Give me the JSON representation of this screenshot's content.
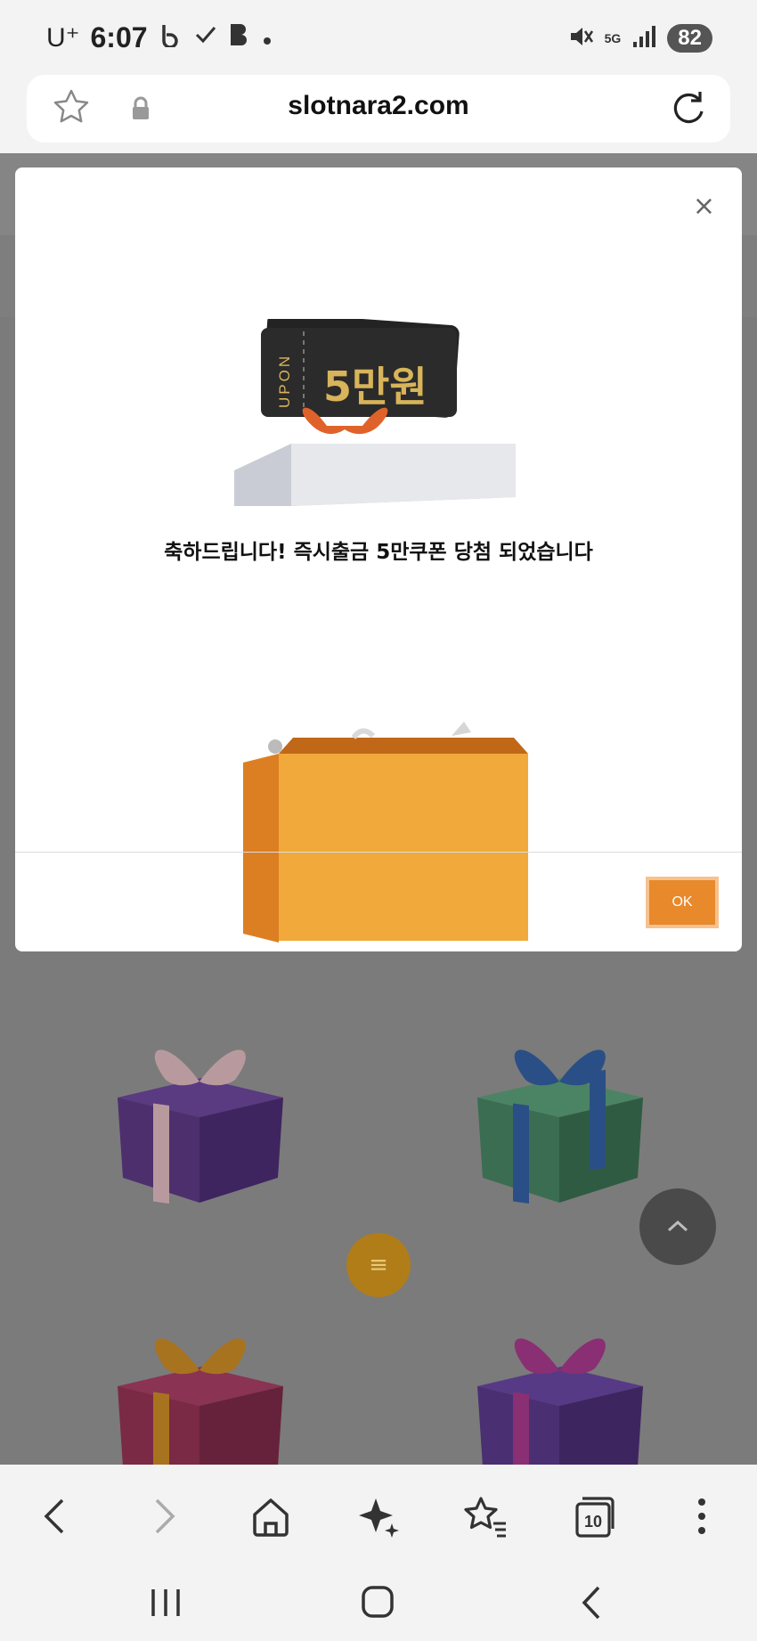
{
  "status_bar": {
    "carrier": "U⁺",
    "time": "6:07",
    "battery": "82",
    "network": "5G"
  },
  "browser": {
    "url": "slotnara2.com"
  },
  "modal": {
    "close_label": "×",
    "coupon_brand": "UPON",
    "coupon_amount": "5만원",
    "message": "축하드립니다! 즉시출금 5만쿠폰 당첨 되었습니다",
    "ok_label": "OK"
  },
  "floating": {
    "menu_icon": "≡",
    "top_icon": "⌃"
  },
  "colors": {
    "accent": "#e8892c",
    "overlay": "#7b7b7b"
  },
  "gifts": [
    {
      "name": "purple-gift",
      "box": "#4d2f6e",
      "ribbon": "#b89a9e"
    },
    {
      "name": "green-gift",
      "box": "#3b6d52",
      "ribbon": "#2a4f86"
    },
    {
      "name": "red-gift",
      "box": "#7a2a45",
      "ribbon": "#a8731f"
    },
    {
      "name": "violet-gift",
      "box": "#4a2f72",
      "ribbon": "#8a2f73"
    }
  ]
}
